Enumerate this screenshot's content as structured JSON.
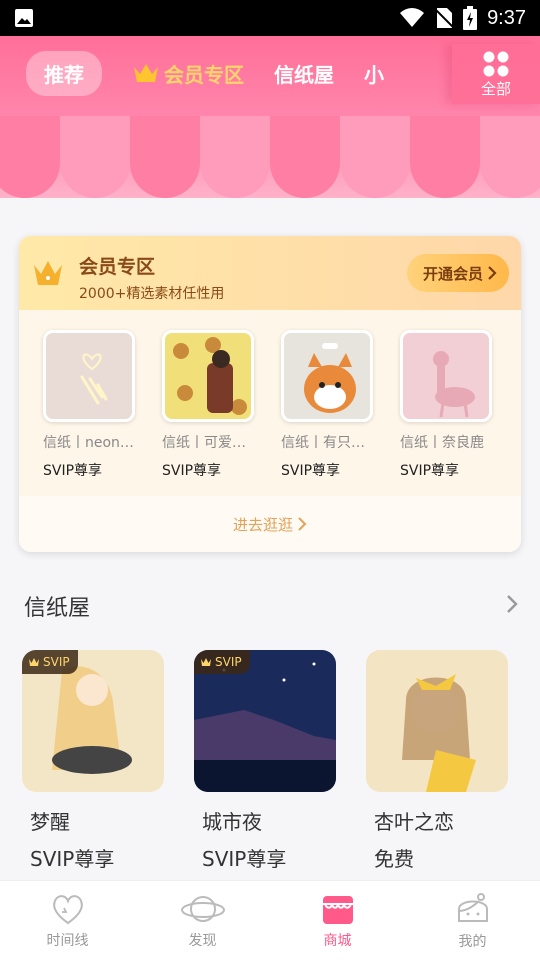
{
  "status_bar": {
    "time": "9:37"
  },
  "header": {
    "tabs": [
      {
        "label": "推荐",
        "active": true
      },
      {
        "label": "会员专区",
        "icon": "crown-icon"
      },
      {
        "label": "信纸屋"
      },
      {
        "label": "小"
      }
    ],
    "all_label": "全部"
  },
  "vip": {
    "title": "会员专区",
    "subtitle": "2000+精选素材任性用",
    "button_label": "开通会员",
    "items": [
      {
        "name": "信纸丨neon…",
        "tier": "SVIP尊享"
      },
      {
        "name": "信纸丨可爱…",
        "tier": "SVIP尊享"
      },
      {
        "name": "信纸丨有只…",
        "tier": "SVIP尊享"
      },
      {
        "name": "信纸丨奈良鹿",
        "tier": "SVIP尊享"
      }
    ],
    "more_label": "进去逛逛"
  },
  "section": {
    "title": "信纸屋",
    "papers": [
      {
        "badge": "SVIP",
        "name": "梦醒",
        "price": "SVIP尊享"
      },
      {
        "badge": "SVIP",
        "name": "城市夜",
        "price": "SVIP尊享"
      },
      {
        "badge": "",
        "name": "杏叶之恋",
        "price": "免费"
      }
    ]
  },
  "bottom_nav": [
    {
      "label": "时间线",
      "icon": "heart-face-icon"
    },
    {
      "label": "发现",
      "icon": "planet-icon"
    },
    {
      "label": "商城",
      "icon": "shop-icon",
      "active": true
    },
    {
      "label": "我的",
      "icon": "profile-icon"
    }
  ],
  "colors": {
    "accent": "#ff5a8a",
    "gold": "#ffd46b"
  }
}
